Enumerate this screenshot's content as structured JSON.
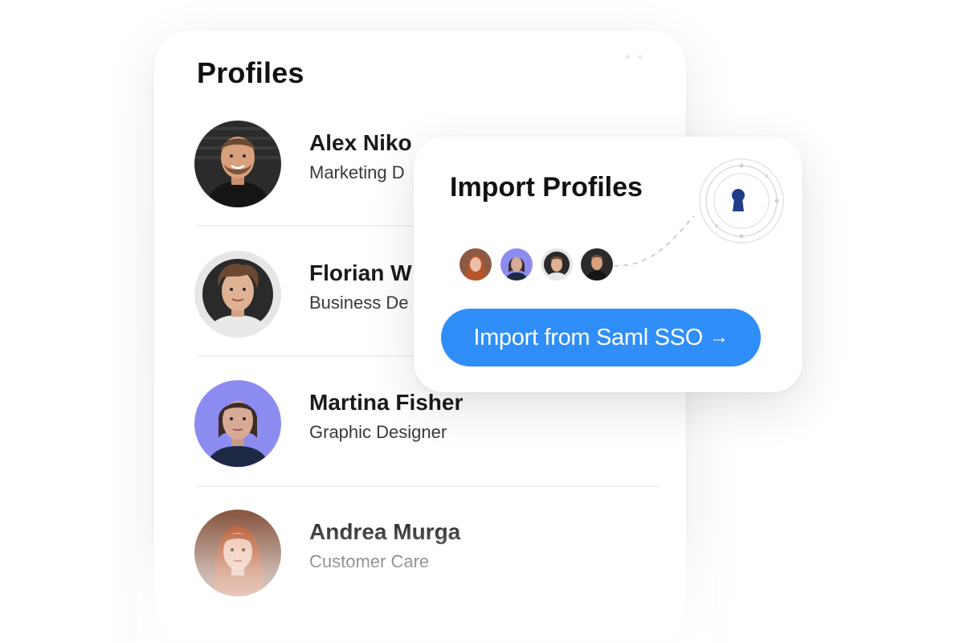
{
  "profiles_panel": {
    "title": "Profiles",
    "people": [
      {
        "name": "Alex Niko",
        "role": "Marketing D",
        "avatar": "alex-photo"
      },
      {
        "name": "Florian W",
        "role": "Business De",
        "avatar": "florian-photo"
      },
      {
        "name": "Martina Fisher",
        "role": "Graphic Designer",
        "avatar": "martina-photo"
      },
      {
        "name": "Andrea Murga",
        "role": "Customer Care",
        "avatar": "andrea-photo"
      }
    ]
  },
  "import_panel": {
    "title": "Import Profiles",
    "button_label": "Import from Saml SSO",
    "button_arrow": "→",
    "lock_icon": "keyhole-icon",
    "avatars": [
      "andrea-photo",
      "martina-photo",
      "florian-photo",
      "alex-photo"
    ]
  },
  "colors": {
    "accent": "#2f8ef8",
    "lock_icon": "#1f3d8a",
    "text_primary": "#111111",
    "text_secondary": "#3a3a3a"
  }
}
